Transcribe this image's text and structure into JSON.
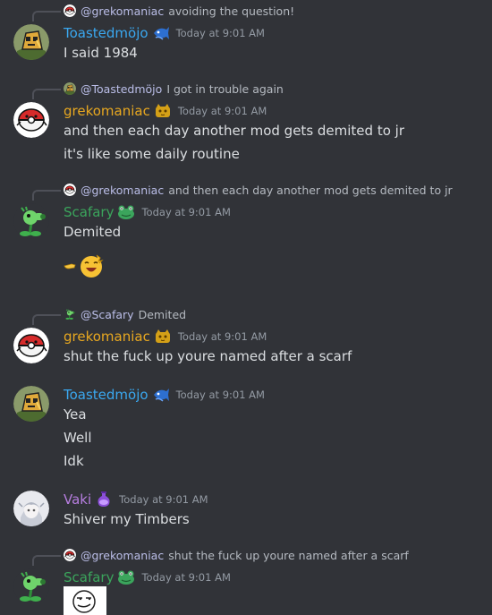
{
  "colors": {
    "background": "#313338",
    "toastedmojo": "#3aa8f0",
    "grekomaniac": "#e8a820",
    "scafary": "#3ba55c",
    "vaki": "#b77ee0",
    "mention": "#c9cdfb",
    "timestamp": "#949ba4"
  },
  "messages": [
    {
      "reply": {
        "mention": "@grekomaniac",
        "text": "avoiding the question!",
        "avatar_icon": "pokeball-avatar-icon"
      },
      "author": "Toastedmöjo",
      "role_icon": "blue-fish-role-icon",
      "timestamp": "Today at 9:01 AM",
      "lines": [
        "I said 1984"
      ]
    },
    {
      "reply": {
        "mention": "@Toastedmöjo",
        "text": "I got in trouble again",
        "avatar_icon": "toast-avatar-icon"
      },
      "author": "grekomaniac",
      "role_icon": "gold-cat-role-icon",
      "timestamp": "Today at 9:01 AM",
      "lines": [
        "and then each day another mod gets demited to jr",
        "it's like some daily routine"
      ]
    },
    {
      "reply": {
        "mention": "@grekomaniac",
        "text": "and then each day another mod gets demited to jr",
        "avatar_icon": "pokeball-avatar-icon"
      },
      "author": "Scafary",
      "role_icon": "frog-role-icon",
      "timestamp": "Today at 9:01 AM",
      "lines": [
        "Demited"
      ],
      "emojis": [
        "pointing-hand-emoji",
        "laughing-face-emoji"
      ]
    },
    {
      "reply": {
        "mention": "@Scafary",
        "text": "Demited",
        "avatar_icon": "peashooter-avatar-icon"
      },
      "author": "grekomaniac",
      "role_icon": "gold-cat-role-icon",
      "timestamp": "Today at 9:01 AM",
      "lines": [
        "shut the fuck up youre named after a scarf"
      ]
    },
    {
      "author": "Toastedmöjo",
      "role_icon": "blue-fish-role-icon",
      "timestamp": "Today at 9:01 AM",
      "lines": [
        "Yea",
        "Well",
        "Idk"
      ]
    },
    {
      "author": "Vaki",
      "role_icon": "purple-potion-role-icon",
      "timestamp": "Today at 9:01 AM",
      "lines": [
        "Shiver my Timbers"
      ]
    },
    {
      "reply": {
        "mention": "@grekomaniac",
        "text": "shut the fuck up youre named after a scarf",
        "avatar_icon": "pokeball-avatar-icon"
      },
      "author": "Scafary",
      "role_icon": "frog-role-icon",
      "timestamp": "Today at 9:01 AM",
      "sticker": "smug-face-sticker"
    }
  ]
}
